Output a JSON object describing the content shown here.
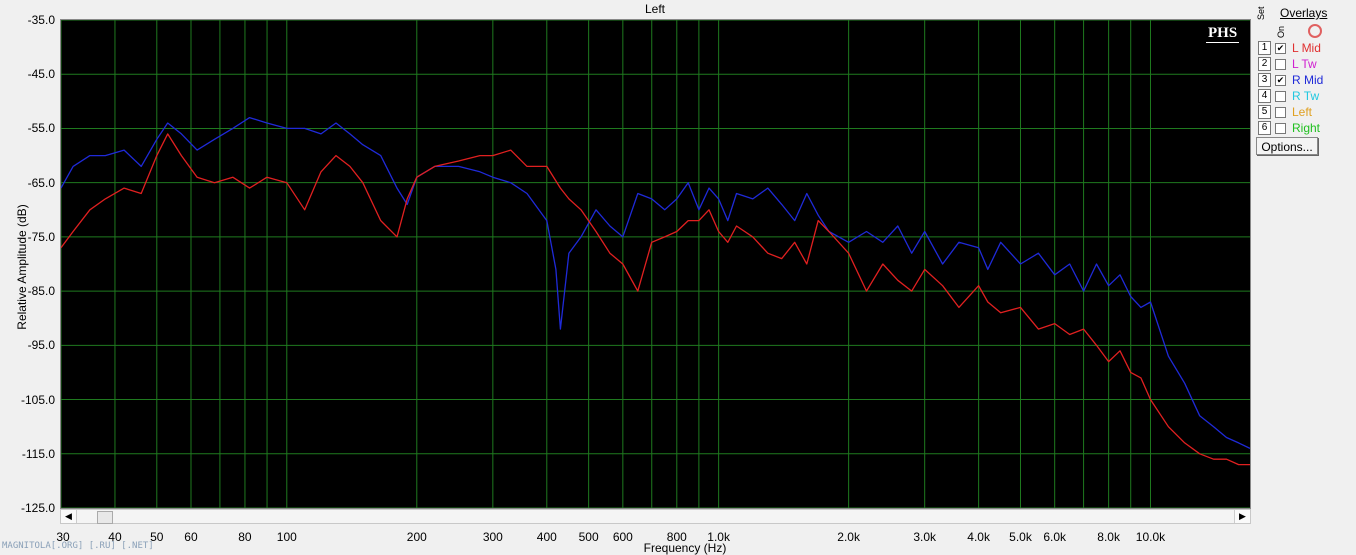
{
  "chart_data": {
    "type": "line",
    "title": "Left",
    "xlabel": "Frequency (Hz)",
    "ylabel": "Relative Amplitude (dB)",
    "xscale": "log",
    "xlim": [
      30,
      17000
    ],
    "ylim": [
      -125,
      -35
    ],
    "grid": true,
    "background": "#000000",
    "grid_color": "#1f7a1f",
    "y_ticks": [
      "-35.0",
      "-45.0",
      "-55.0",
      "-65.0",
      "-75.0",
      "-85.0",
      "-95.0",
      "-105.0",
      "-115.0",
      "-125.0"
    ],
    "y_tick_values": [
      -35,
      -45,
      -55,
      -65,
      -75,
      -85,
      -95,
      -105,
      -115,
      -125
    ],
    "x_ticks": [
      {
        "v": 30,
        "label": "30"
      },
      {
        "v": 40,
        "label": "40"
      },
      {
        "v": 50,
        "label": "50"
      },
      {
        "v": 60,
        "label": "60"
      },
      {
        "v": 80,
        "label": "80"
      },
      {
        "v": 100,
        "label": "100"
      },
      {
        "v": 200,
        "label": "200"
      },
      {
        "v": 300,
        "label": "300"
      },
      {
        "v": 400,
        "label": "400"
      },
      {
        "v": 500,
        "label": "500"
      },
      {
        "v": 600,
        "label": "600"
      },
      {
        "v": 800,
        "label": "800"
      },
      {
        "v": 1000,
        "label": "1.0k"
      },
      {
        "v": 2000,
        "label": "2.0k"
      },
      {
        "v": 3000,
        "label": "3.0k"
      },
      {
        "v": 4000,
        "label": "4.0k"
      },
      {
        "v": 5000,
        "label": "5.0k"
      },
      {
        "v": 6000,
        "label": "6.0k"
      },
      {
        "v": 8000,
        "label": "8.0k"
      },
      {
        "v": 10000,
        "label": "10.0k"
      }
    ],
    "grid_lines_x": [
      30,
      40,
      50,
      60,
      70,
      80,
      90,
      100,
      200,
      300,
      400,
      500,
      600,
      700,
      800,
      900,
      1000,
      2000,
      3000,
      4000,
      5000,
      6000,
      7000,
      8000,
      9000,
      10000
    ],
    "series": [
      {
        "name": "R Mid",
        "color": "#1f2ad8",
        "x": [
          30,
          32,
          35,
          38,
          42,
          46,
          50,
          53,
          57,
          62,
          68,
          75,
          82,
          90,
          100,
          110,
          120,
          130,
          140,
          150,
          165,
          180,
          190,
          200,
          220,
          250,
          280,
          300,
          330,
          360,
          400,
          420,
          430,
          450,
          480,
          520,
          560,
          600,
          650,
          700,
          750,
          800,
          850,
          900,
          950,
          1000,
          1050,
          1100,
          1200,
          1300,
          1400,
          1500,
          1600,
          1700,
          1800,
          2000,
          2200,
          2400,
          2600,
          2800,
          3000,
          3300,
          3600,
          4000,
          4200,
          4500,
          5000,
          5500,
          6000,
          6500,
          7000,
          7500,
          8000,
          8500,
          9000,
          9500,
          10000,
          11000,
          12000,
          13000,
          14000,
          15000,
          16000,
          17000
        ],
        "y": [
          -66,
          -62,
          -60,
          -60,
          -59,
          -62,
          -57,
          -54,
          -56,
          -59,
          -57,
          -55,
          -53,
          -54,
          -55,
          -55,
          -56,
          -54,
          -56,
          -58,
          -60,
          -66,
          -69,
          -64,
          -62,
          -62,
          -63,
          -64,
          -65,
          -67,
          -72,
          -81,
          -92,
          -78,
          -75,
          -70,
          -73,
          -75,
          -67,
          -68,
          -70,
          -68,
          -65,
          -70,
          -66,
          -68,
          -72,
          -67,
          -68,
          -66,
          -69,
          -72,
          -67,
          -71,
          -74,
          -76,
          -74,
          -76,
          -73,
          -78,
          -74,
          -80,
          -76,
          -77,
          -81,
          -76,
          -80,
          -78,
          -82,
          -80,
          -85,
          -80,
          -84,
          -82,
          -86,
          -88,
          -87,
          -97,
          -102,
          -108,
          -110,
          -112,
          -113,
          -114
        ]
      },
      {
        "name": "L Mid",
        "color": "#e02020",
        "x": [
          30,
          32,
          35,
          38,
          42,
          46,
          50,
          53,
          57,
          62,
          68,
          75,
          82,
          90,
          100,
          110,
          120,
          130,
          140,
          150,
          165,
          180,
          190,
          200,
          220,
          250,
          280,
          300,
          330,
          360,
          400,
          430,
          450,
          480,
          520,
          560,
          600,
          650,
          700,
          750,
          800,
          850,
          900,
          950,
          1000,
          1050,
          1100,
          1200,
          1300,
          1400,
          1500,
          1600,
          1700,
          1800,
          2000,
          2200,
          2400,
          2600,
          2800,
          3000,
          3300,
          3600,
          4000,
          4200,
          4500,
          5000,
          5500,
          6000,
          6500,
          7000,
          7500,
          8000,
          8500,
          9000,
          9500,
          10000,
          11000,
          12000,
          13000,
          14000,
          15000,
          16000,
          17000
        ],
        "y": [
          -77,
          -74,
          -70,
          -68,
          -66,
          -67,
          -60,
          -56,
          -60,
          -64,
          -65,
          -64,
          -66,
          -64,
          -65,
          -70,
          -63,
          -60,
          -62,
          -65,
          -72,
          -75,
          -68,
          -64,
          -62,
          -61,
          -60,
          -60,
          -59,
          -62,
          -62,
          -66,
          -68,
          -70,
          -74,
          -78,
          -80,
          -85,
          -76,
          -75,
          -74,
          -72,
          -72,
          -70,
          -74,
          -76,
          -73,
          -75,
          -78,
          -79,
          -76,
          -80,
          -72,
          -74,
          -78,
          -85,
          -80,
          -83,
          -85,
          -81,
          -84,
          -88,
          -84,
          -87,
          -89,
          -88,
          -92,
          -91,
          -93,
          -92,
          -95,
          -98,
          -96,
          -100,
          -101,
          -105,
          -110,
          -113,
          -115,
          -116,
          -116,
          -117,
          -117
        ]
      }
    ]
  },
  "watermark": "MAGNITOLA[.ORG] [.RU] [.NET]",
  "badge": "PHS",
  "overlays": {
    "title": "Overlays",
    "col_set": "Set",
    "col_on": "On",
    "items": [
      {
        "num": "1",
        "checked": true,
        "label": "L Mid",
        "color": "#e03030"
      },
      {
        "num": "2",
        "checked": false,
        "label": "L Tw",
        "color": "#d020d0"
      },
      {
        "num": "3",
        "checked": true,
        "label": "R Mid",
        "color": "#1f2ad8"
      },
      {
        "num": "4",
        "checked": false,
        "label": "R Tw",
        "color": "#20c8e0"
      },
      {
        "num": "5",
        "checked": false,
        "label": "Left",
        "color": "#e0a020"
      },
      {
        "num": "6",
        "checked": false,
        "label": "Right",
        "color": "#20c020"
      }
    ],
    "options_label": "Options..."
  },
  "scrollbar": {
    "left_arrow": "◀",
    "right_arrow": "▶"
  }
}
